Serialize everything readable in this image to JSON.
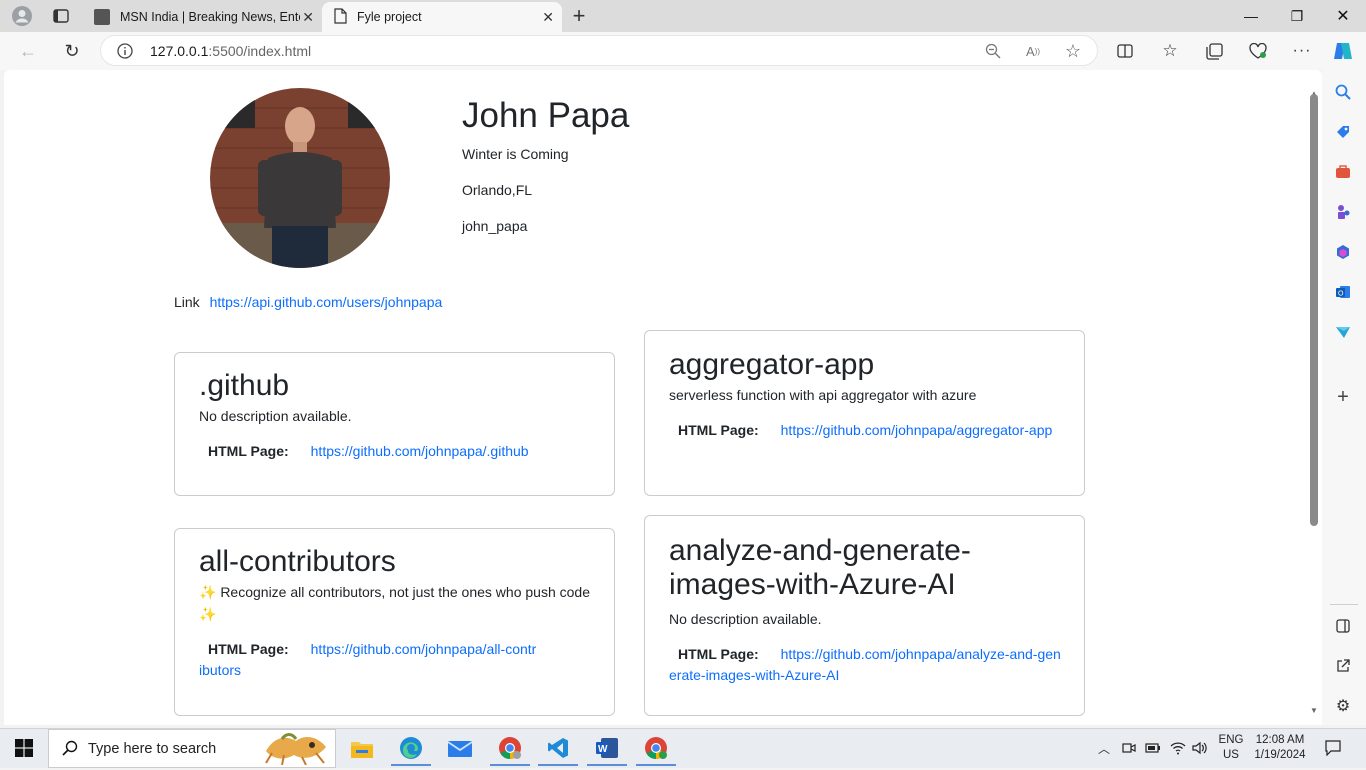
{
  "browser": {
    "tabs": [
      {
        "title": "MSN India | Breaking News, Ente",
        "active": false
      },
      {
        "title": "Fyle project",
        "active": true
      }
    ],
    "address": {
      "host": "127.0.0.1",
      "rest": ":5500/index.html"
    }
  },
  "profile": {
    "name": "John Papa",
    "bio": "Winter is Coming",
    "location": "Orlando,FL",
    "username": "john_papa",
    "link_label": "Link",
    "link_url": "https://api.github.com/users/johnpapa"
  },
  "repos": [
    {
      "name": ".github",
      "description": "No description available.",
      "html_label": "HTML Page:",
      "url": "https://github.com/johnpapa/.github"
    },
    {
      "name": "aggregator-app",
      "description": "serverless function with api aggregator with azure",
      "html_label": "HTML Page:",
      "url": "https://github.com/johnpapa/aggregator-app"
    },
    {
      "name": "all-contributors",
      "description": "✨ Recognize all contributors, not just the ones who push code ✨",
      "html_label": "HTML Page:",
      "url": "https://github.com/johnpapa/all-contributors"
    },
    {
      "name": "analyze-and-generate-images-with-Azure-AI",
      "description": "No description available.",
      "html_label": "HTML Page:",
      "url": "https://github.com/johnpapa/analyze-and-generate-images-with-Azure-AI"
    }
  ],
  "taskbar": {
    "search_placeholder": "Type here to search",
    "lang": "ENG",
    "region": "US",
    "time": "12:08 AM",
    "date": "1/19/2024"
  },
  "colors": {
    "link": "#0d6efd",
    "accent": "#5a8ed6"
  }
}
